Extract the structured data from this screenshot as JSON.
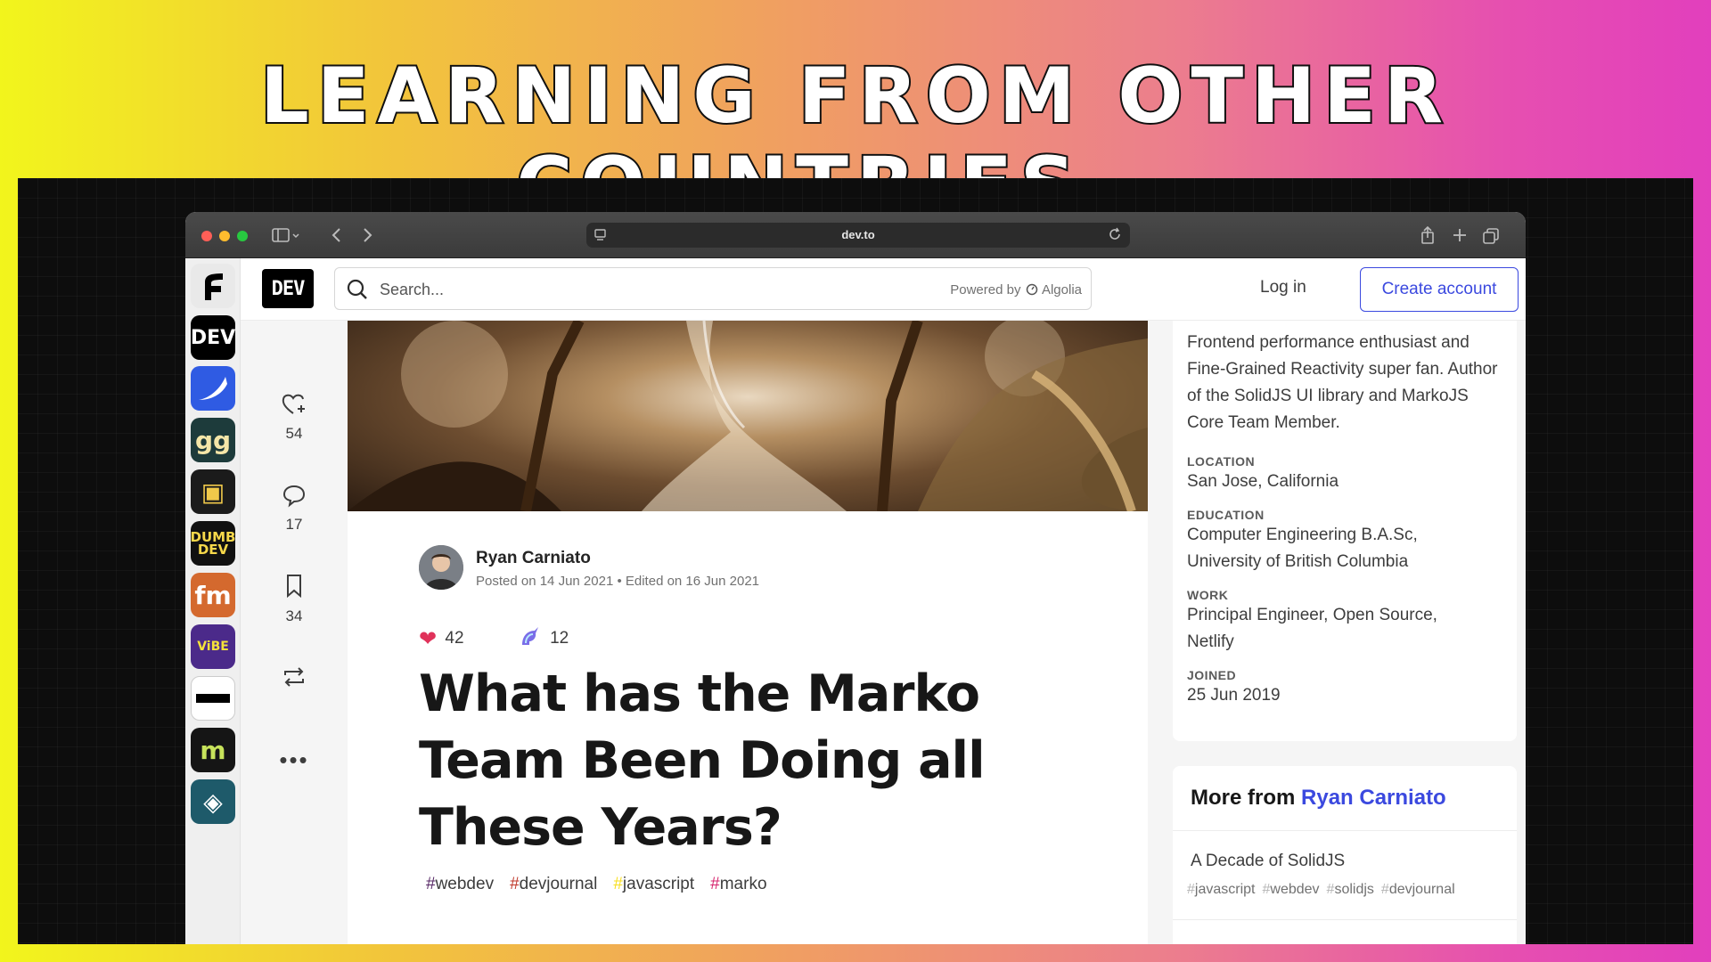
{
  "headline": "LEARNING FROM OTHER COUNTRIES...",
  "browser": {
    "url": "dev.to"
  },
  "header": {
    "logo": "DEV",
    "search_placeholder": "Search...",
    "powered_by": "Powered by",
    "powered_brand": "Algolia",
    "login": "Log in",
    "create_account": "Create account"
  },
  "apps": [
    {
      "name": "forem",
      "label": "F",
      "bg": "#e9e9e9",
      "fg": "#000000"
    },
    {
      "name": "dev",
      "label": "DEV",
      "bg": "#000000",
      "fg": "#ffffff"
    },
    {
      "name": "blue-app",
      "label": "",
      "bg": "#2f5be3",
      "fg": "#ffffff"
    },
    {
      "name": "gg",
      "label": "gg",
      "bg": "#1d3b3b",
      "fg": "#f4e6a8"
    },
    {
      "name": "tv-app",
      "label": "▣",
      "bg": "#1b1b1b",
      "fg": "#f0c94a"
    },
    {
      "name": "dumbdev",
      "label": "DUMB DEV",
      "bg": "#111111",
      "fg": "#f6d84a"
    },
    {
      "name": "fm",
      "label": "fm",
      "bg": "#d4692e",
      "fg": "#ffffff"
    },
    {
      "name": "vibe",
      "label": "ViBE",
      "bg": "#4b2a8a",
      "fg": "#f4e23a"
    },
    {
      "name": "bar-app",
      "label": "",
      "bg": "#ffffff",
      "fg": "#000000"
    },
    {
      "name": "m-app",
      "label": "m",
      "bg": "#151515",
      "fg": "#c7e35b"
    },
    {
      "name": "drop-app",
      "label": "◈",
      "bg": "#1e5a6a",
      "fg": "#ffffff"
    }
  ],
  "reactions": {
    "likes": "54",
    "comments": "17",
    "bookmarks": "34"
  },
  "article": {
    "author": "Ryan Carniato",
    "posted": "Posted on 14 Jun 2021 • Edited on 16 Jun 2021",
    "hearts": "42",
    "unicorns": "12",
    "title": "What has the Marko Team Been Doing all These Years?",
    "tags": [
      {
        "label": "webdev",
        "color": "#562765"
      },
      {
        "label": "devjournal",
        "color": "#c0392b"
      },
      {
        "label": "javascript",
        "color": "#f7df1e"
      },
      {
        "label": "marko",
        "color": "#d6246e"
      }
    ]
  },
  "profile": {
    "bio": "Frontend performance enthusiast and Fine-Grained Reactivity super fan. Author of the SolidJS UI library and MarkoJS Core Team Member.",
    "location_label": "LOCATION",
    "location": "San Jose, California",
    "education_label": "EDUCATION",
    "education": "Computer Engineering B.A.Sc, University of British Columbia",
    "work_label": "WORK",
    "work": "Principal Engineer, Open Source, Netlify",
    "joined_label": "JOINED",
    "joined": "25 Jun 2019"
  },
  "more": {
    "heading": "More from",
    "author": "Ryan Carniato",
    "item_title": "A Decade of SolidJS",
    "item_tags": [
      "javascript",
      "webdev",
      "solidjs",
      "devjournal"
    ]
  }
}
